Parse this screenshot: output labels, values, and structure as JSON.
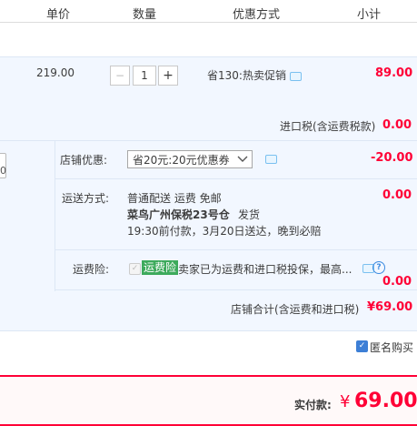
{
  "header": {
    "col_price": "单价",
    "col_qty": "数量",
    "col_promo": "优惠方式",
    "col_subtotal": "小计"
  },
  "item": {
    "unit_price": "219.00",
    "quantity": "1",
    "minus": "−",
    "plus": "+",
    "promo": "省130:热卖促销",
    "subtotal": "89.00"
  },
  "import_tax": {
    "label": "进口税(含运费税款)",
    "value": "0.00"
  },
  "store_discount": {
    "label": "店铺优惠:",
    "selected": "省20元:20元优惠券",
    "value": "-20.00"
  },
  "shipping": {
    "label": "运送方式:",
    "line1": "普通配送 运费 免邮",
    "line2_bold": "菜鸟广州保税23号仓",
    "line2_rest": "发货",
    "line3": "19:30前付款，3月20日送达，晚到必赔",
    "value": "0.00"
  },
  "insurance": {
    "label": "运费险:",
    "badge": "运费险",
    "desc": "卖家已为运费和进口税投保，最高...",
    "help": "?",
    "value": "0.00"
  },
  "store_total": {
    "label": "店铺合计(含运费和进口税)",
    "value": "¥69.00"
  },
  "anonymous": {
    "label": "匿名购买",
    "checked": true
  },
  "payment": {
    "label": "实付款:",
    "currency": "¥",
    "amount": "69.00"
  },
  "left_stub": "0",
  "colors": {
    "accent_red": "#ff0036",
    "band_blue": "#f2f7ff",
    "badge_green": "#3daa5c",
    "checkbox_blue": "#3d7fd6"
  }
}
